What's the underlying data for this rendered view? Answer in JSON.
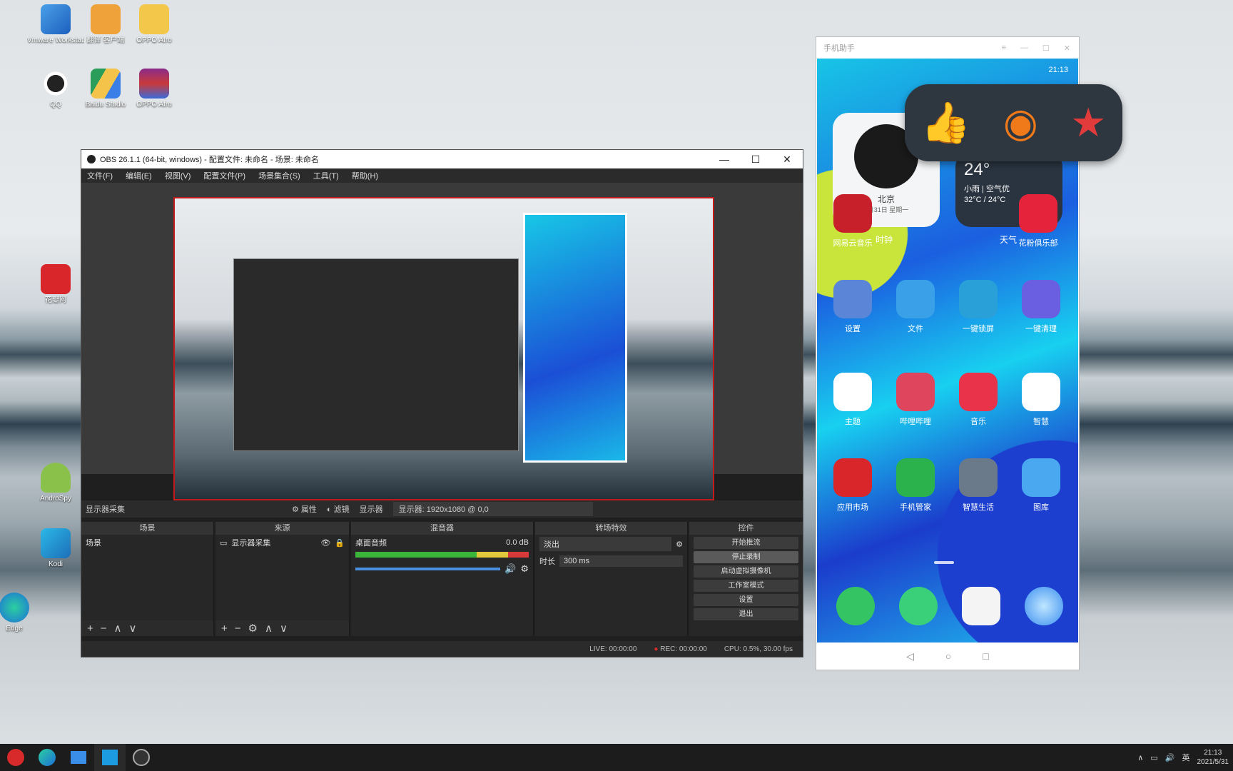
{
  "colors": {
    "obs_bg": "#1f1f1f",
    "preview_border": "#c21a1a",
    "taskbar": "#1c1c1c",
    "badge_like": "#3a7ee8",
    "badge_coin": "#f07a1a",
    "badge_star": "#e23b3b"
  },
  "desktop": {
    "icons": [
      {
        "label": "Vmware Workstati...",
        "icon": "vmware-icon"
      },
      {
        "label": "翻译 客户端",
        "icon": "sign-file-icon"
      },
      {
        "label": "OPPO Afro",
        "icon": "folder-icon"
      },
      {
        "label": "QQ",
        "icon": "qq-icon"
      },
      {
        "label": "Baidu Studio",
        "icon": "google-drive-icon"
      },
      {
        "label": "OPPO Afro",
        "icon": "winrar-icon"
      },
      {
        "label": "花瓣网",
        "icon": "huawei-icon"
      },
      {
        "label": "AndroSpy",
        "icon": "android-icon"
      },
      {
        "label": "Kodi",
        "icon": "kodi-icon"
      },
      {
        "label": "Edge",
        "icon": "edge-icon"
      }
    ]
  },
  "obs": {
    "title": "OBS 26.1.1 (64-bit, windows) - 配置文件: 未命名 - 场景: 未命名",
    "menu": [
      "文件(F)",
      "编辑(E)",
      "视图(V)",
      "配置文件(P)",
      "场景集合(S)",
      "工具(T)",
      "帮助(H)"
    ],
    "sourcebar": {
      "label": "显示器采集",
      "props": "属性",
      "filters": "滤镜",
      "display": "显示器",
      "display_value": "显示器: 1920x1080 @ 0,0"
    },
    "docks": {
      "scenes": {
        "header": "场景",
        "item": "场景"
      },
      "sources": {
        "header": "来源",
        "item": "显示器采集"
      },
      "mixer": {
        "header": "混音器",
        "channel": "桌面音频",
        "level": "0.0 dB"
      },
      "transitions": {
        "header": "转场特效",
        "type": "淡出",
        "duration_label": "时长",
        "duration": "300 ms"
      },
      "controls": {
        "header": "控件",
        "buttons": [
          "开始推流",
          "停止录制",
          "启动虚拟摄像机",
          "工作室模式",
          "设置",
          "退出"
        ]
      }
    },
    "status": {
      "live": "LIVE: 00:00:00",
      "rec": "REC: 00:00:00",
      "cpu": "CPU: 0.5%, 30.00 fps"
    }
  },
  "phone": {
    "title": "手机助手",
    "status_time": "21:13",
    "clock_widget": {
      "city": "北京",
      "date": "5月31日 星期一",
      "caption": "时钟"
    },
    "weather_widget": {
      "temp": "24°",
      "desc": "小雨 | 空气优",
      "range": "32°C / 24°C",
      "caption": "天气"
    },
    "apps": [
      {
        "label": "网易云音乐",
        "color": "#c8202a"
      },
      {
        "label": "花粉俱乐部",
        "color": "#e5243b"
      },
      {
        "label": "设置",
        "color": "#5b86d8"
      },
      {
        "label": "文件",
        "color": "#3aa0e8"
      },
      {
        "label": "一键锁屏",
        "color": "#2aa0d8"
      },
      {
        "label": "一键清理",
        "color": "#6a5fe0"
      },
      {
        "label": "主题",
        "color": "#ffffff"
      },
      {
        "label": "哔哩哔哩",
        "color": "#e0455e"
      },
      {
        "label": "音乐",
        "color": "#e8334a"
      },
      {
        "label": "智慧",
        "color": "#ffffff"
      },
      {
        "label": "应用市场",
        "color": "#d8262b"
      },
      {
        "label": "手机管家",
        "color": "#2bb24c"
      },
      {
        "label": "智慧生活",
        "color": "#6a7a8a"
      },
      {
        "label": "图库",
        "color": "#4aa8f0"
      }
    ],
    "dock": [
      "phone",
      "messages",
      "camera",
      "browser"
    ]
  },
  "taskbar": {
    "time": "21:13",
    "date": "2021/5/31",
    "lang": "英"
  }
}
